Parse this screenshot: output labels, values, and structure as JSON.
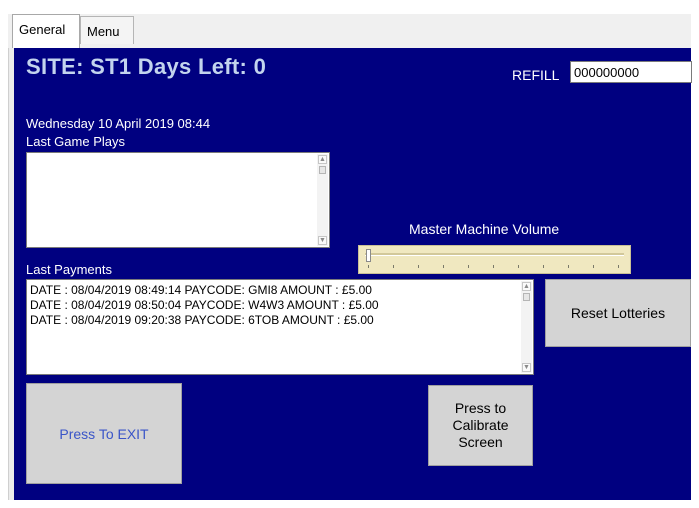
{
  "tabs": [
    {
      "label": "General",
      "active": true
    },
    {
      "label": "Menu",
      "active": false
    }
  ],
  "header": {
    "title": "SITE: ST1 Days Left: 0",
    "refill_label": "REFILL",
    "refill_value": "000000000"
  },
  "status": {
    "datetime": "Wednesday 10 April 2019 08:44"
  },
  "last_game_plays": {
    "label": "Last Game Plays",
    "items": []
  },
  "volume": {
    "label": "Master Machine Volume",
    "value_fraction": 0.0
  },
  "last_payments": {
    "label": "Last  Payments",
    "items": [
      "DATE : 08/04/2019 08:49:14 PAYCODE: GMI8 AMOUNT : £5.00",
      "DATE : 08/04/2019 08:50:04 PAYCODE: W4W3 AMOUNT : £5.00",
      "DATE : 08/04/2019 09:20:38 PAYCODE: 6TOB AMOUNT : £5.00"
    ]
  },
  "buttons": {
    "reset_lotteries": "Reset Lotteries",
    "exit": "Press To EXIT",
    "calibrate_lines": [
      "Press to",
      "Calibrate",
      "Screen"
    ]
  },
  "colors": {
    "panel_bg": "#000080",
    "title_text": "#c3d4ee",
    "exit_text": "#3a55c8",
    "slider_bg": "#f0e8c0"
  }
}
